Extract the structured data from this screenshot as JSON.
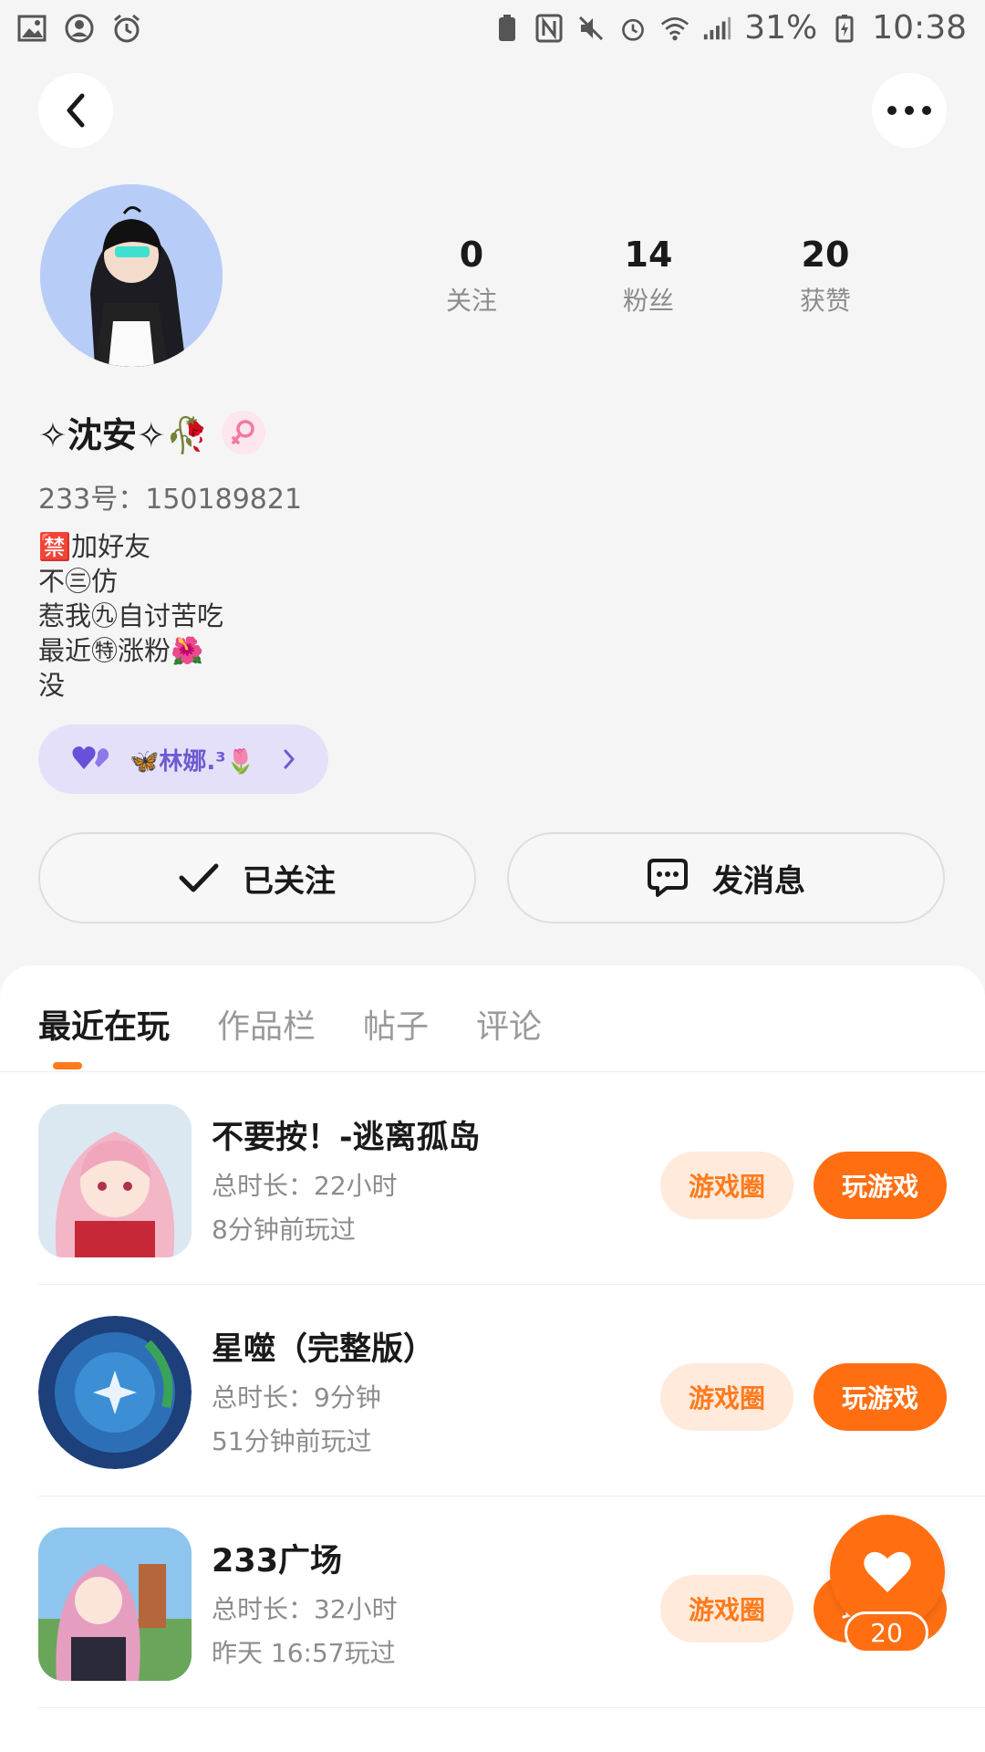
{
  "status_bar": {
    "battery": "31%",
    "time": "10:38"
  },
  "profile": {
    "nickname": "✧沈安✧🥀",
    "uid_text": "233号：150189821",
    "bio_lines": [
      "🈲加好友",
      "不㊂仿",
      "惹我㊈自讨苦吃",
      "最近㊕涨粉🌺",
      "没"
    ],
    "fan_tag": "🦋林娜.³🌷",
    "stats": [
      {
        "value": "0",
        "label": "关注"
      },
      {
        "value": "14",
        "label": "粉丝"
      },
      {
        "value": "20",
        "label": "获赞"
      }
    ]
  },
  "actions": {
    "follow_label": "已关注",
    "message_label": "发消息"
  },
  "tabs": [
    {
      "label": "最近在玩",
      "active": true
    },
    {
      "label": "作品栏",
      "active": false
    },
    {
      "label": "帖子",
      "active": false
    },
    {
      "label": "评论",
      "active": false
    }
  ],
  "games": [
    {
      "title": "不要按！-逃离孤岛",
      "duration": "总时长：22小时",
      "last_played": "8分钟前玩过"
    },
    {
      "title": "星噬（完整版）",
      "duration": "总时长：9分钟",
      "last_played": "51分钟前玩过"
    },
    {
      "title": "233广场",
      "duration": "总时长：32小时",
      "last_played": "昨天 16:57玩过"
    }
  ],
  "game_buttons": {
    "circle_label": "游戏圈",
    "play_label": "玩游戏"
  },
  "like_count": "20",
  "colors": {
    "accent": "#ff6f12",
    "accent_light": "#ffeadb",
    "pill_bg": "#e5e0fa"
  }
}
